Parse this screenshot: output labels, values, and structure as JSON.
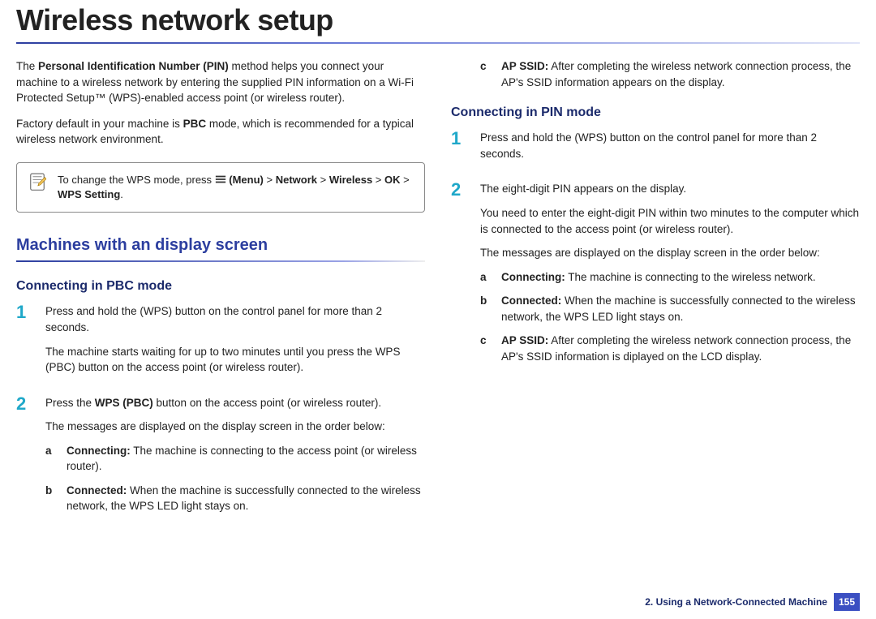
{
  "title": "Wireless network setup",
  "intro": {
    "p1_pre": "The ",
    "p1_bold": "Personal Identification Number (PIN)",
    "p1_post": " method helps you connect your machine to a wireless network by entering the supplied PIN information on a Wi-Fi Protected Setup™ (WPS)-enabled access point (or wireless router).",
    "p2_pre": "Factory default in your machine is ",
    "p2_bold": "PBC",
    "p2_post": " mode, which is recommended for a typical wireless network environment."
  },
  "note": {
    "text_pre": "To change the WPS mode, press ",
    "menu_label": " (Menu)",
    "path_mid": " > ",
    "path_network": "Network",
    "path_wireless": "Wireless",
    "path_ok": "OK",
    "path_wpssetting": "WPS Setting",
    "gt": " > ",
    "period": "."
  },
  "main_section": "Machines with an display screen",
  "pbc": {
    "heading": "Connecting in PBC mode",
    "step1_num": "1",
    "step1_p1": "Press and hold the        (WPS) button on the control panel for more than 2 seconds.",
    "step1_p2": "The machine starts waiting for up to two minutes until you press the WPS (PBC) button on the access point (or wireless router).",
    "step2_num": "2",
    "step2_p1_pre": "Press the ",
    "step2_p1_bold": "WPS (PBC)",
    "step2_p1_post": " button on the access point (or wireless router).",
    "step2_p2": "The messages are displayed on the display screen in the order below:",
    "a_key": "a",
    "a_bold": "Connecting:",
    "a_text": " The machine is connecting to the access point (or wireless router).",
    "b_key": "b",
    "b_bold": "Connected:",
    "b_text": " When the machine is successfully connected to the wireless network, the WPS LED light stays on."
  },
  "right_continuation": {
    "c_key": "c",
    "c_bold": "AP SSID:",
    "c_text": " After completing the wireless network connection process, the AP's SSID information appears on the display."
  },
  "pin": {
    "heading": "Connecting in PIN mode",
    "step1_num": "1",
    "step1_p1": "Press and hold the        (WPS) button on the control panel for more than 2 seconds.",
    "step2_num": "2",
    "step2_p1": "The eight-digit PIN appears on the display.",
    "step2_p2": "You need to enter the eight-digit PIN within two minutes to the computer which is connected to the access point (or wireless router).",
    "step2_p3": "The messages are displayed on the display screen in the order below:",
    "a_key": "a",
    "a_bold": "Connecting:",
    "a_text": " The machine is connecting to the wireless network.",
    "b_key": "b",
    "b_bold": "Connected:",
    "b_text": " When the machine is successfully connected to the wireless network, the WPS LED light stays on.",
    "c_key": "c",
    "c_bold": "AP SSID:",
    "c_text": " After completing the wireless network connection process, the AP's SSID information is diplayed on the LCD display."
  },
  "footer": {
    "chapter": "2.  Using a Network-Connected Machine",
    "page": "155"
  }
}
